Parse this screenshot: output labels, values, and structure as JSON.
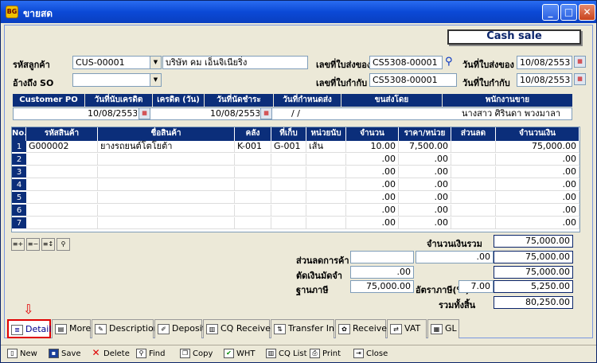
{
  "window": {
    "title": "ขายสด",
    "app_icon_text": "BG"
  },
  "banner": "Cash sale",
  "form": {
    "customer_code_label": "รหัสลูกค้า",
    "customer_code": "CUS-00001",
    "customer_name": "บริษัท คม เอ็นจิเนียริ่ง",
    "ref_so_label": "อ้างถึง SO",
    "ref_so": "",
    "delivery_no_label": "เลขที่ใบส่งของ",
    "delivery_no": "CS5308-00001",
    "delivery_date_label": "วันที่ใบส่งของ",
    "delivery_date": "10/08/2553",
    "tax_no_label": "เลขที่ใบกำกับ",
    "tax_no": "CS5308-00001",
    "tax_date_label": "วันที่ใบกำกับ",
    "tax_date": "10/08/2553"
  },
  "info_headers": [
    "Customer PO",
    "วันที่นับเครดิต",
    "เครดิต (วัน)",
    "วันที่นัดชำระ",
    "วันที่กำหนดส่ง",
    "ขนส่งโดย",
    "พนักงานขาย"
  ],
  "info_values": {
    "customer_po": "",
    "credit_start": "10/08/2553",
    "credit_days": "",
    "due_date": "10/08/2553",
    "ship_date": " /  /",
    "shipper": "",
    "salesperson": "นางสาว ศิรินดา พวงมาลา"
  },
  "grid": {
    "headers": [
      "No.",
      "รหัสสินค้า",
      "ชื่อสินค้า",
      "คลัง",
      "ที่เก็บ",
      "หน่วยนับ",
      "จำนวน",
      "ราคา/หน่วย",
      "ส่วนลด",
      "จำนวนเงิน"
    ],
    "rows": [
      {
        "no": "1",
        "code": "G000002",
        "name": "ยางรถยนต์โตโยต้า",
        "wh": "K-001",
        "loc": "G-001",
        "unit": "เส้น",
        "qty": "10.00",
        "price": "7,500.00",
        "disc": "",
        "amount": "75,000.00"
      },
      {
        "no": "2",
        "code": "",
        "name": "",
        "wh": "",
        "loc": "",
        "unit": "",
        "qty": ".00",
        "price": ".00",
        "disc": "",
        "amount": ".00"
      },
      {
        "no": "3",
        "code": "",
        "name": "",
        "wh": "",
        "loc": "",
        "unit": "",
        "qty": ".00",
        "price": ".00",
        "disc": "",
        "amount": ".00"
      },
      {
        "no": "4",
        "code": "",
        "name": "",
        "wh": "",
        "loc": "",
        "unit": "",
        "qty": ".00",
        "price": ".00",
        "disc": "",
        "amount": ".00"
      },
      {
        "no": "5",
        "code": "",
        "name": "",
        "wh": "",
        "loc": "",
        "unit": "",
        "qty": ".00",
        "price": ".00",
        "disc": "",
        "amount": ".00"
      },
      {
        "no": "6",
        "code": "",
        "name": "",
        "wh": "",
        "loc": "",
        "unit": "",
        "qty": ".00",
        "price": ".00",
        "disc": "",
        "amount": ".00"
      },
      {
        "no": "7",
        "code": "",
        "name": "",
        "wh": "",
        "loc": "",
        "unit": "",
        "qty": ".00",
        "price": ".00",
        "disc": "",
        "amount": ".00"
      }
    ]
  },
  "totals": {
    "sum_label": "จำนวนเงินรวม",
    "sum": "75,000.00",
    "trade_disc_label": "ส่วนลดการค้า",
    "trade_disc_input": "",
    "trade_disc_value": ".00",
    "after_disc": "75,000.00",
    "deposit_label": "ตัดเงินมัดจำ",
    "deposit": ".00",
    "after_deposit": "75,000.00",
    "base_label": "ฐานภาษี",
    "base": "75,000.00",
    "vat_rate_label": "อัตราภาษี(%)",
    "vat_rate": "7.00",
    "vat": "5,250.00",
    "grand_label": "รวมทั้งสิ้น",
    "grand": "80,250.00"
  },
  "tabs": [
    "Detail",
    "More",
    "Description",
    "Deposit",
    "CQ Receive",
    "Transfer In",
    "Receive",
    "VAT",
    "GL"
  ],
  "arrow": "⇩",
  "toolbar": [
    "New",
    "Save",
    "Delete",
    "Find",
    "Copy",
    "WHT",
    "CQ List",
    "Print",
    "Close"
  ]
}
